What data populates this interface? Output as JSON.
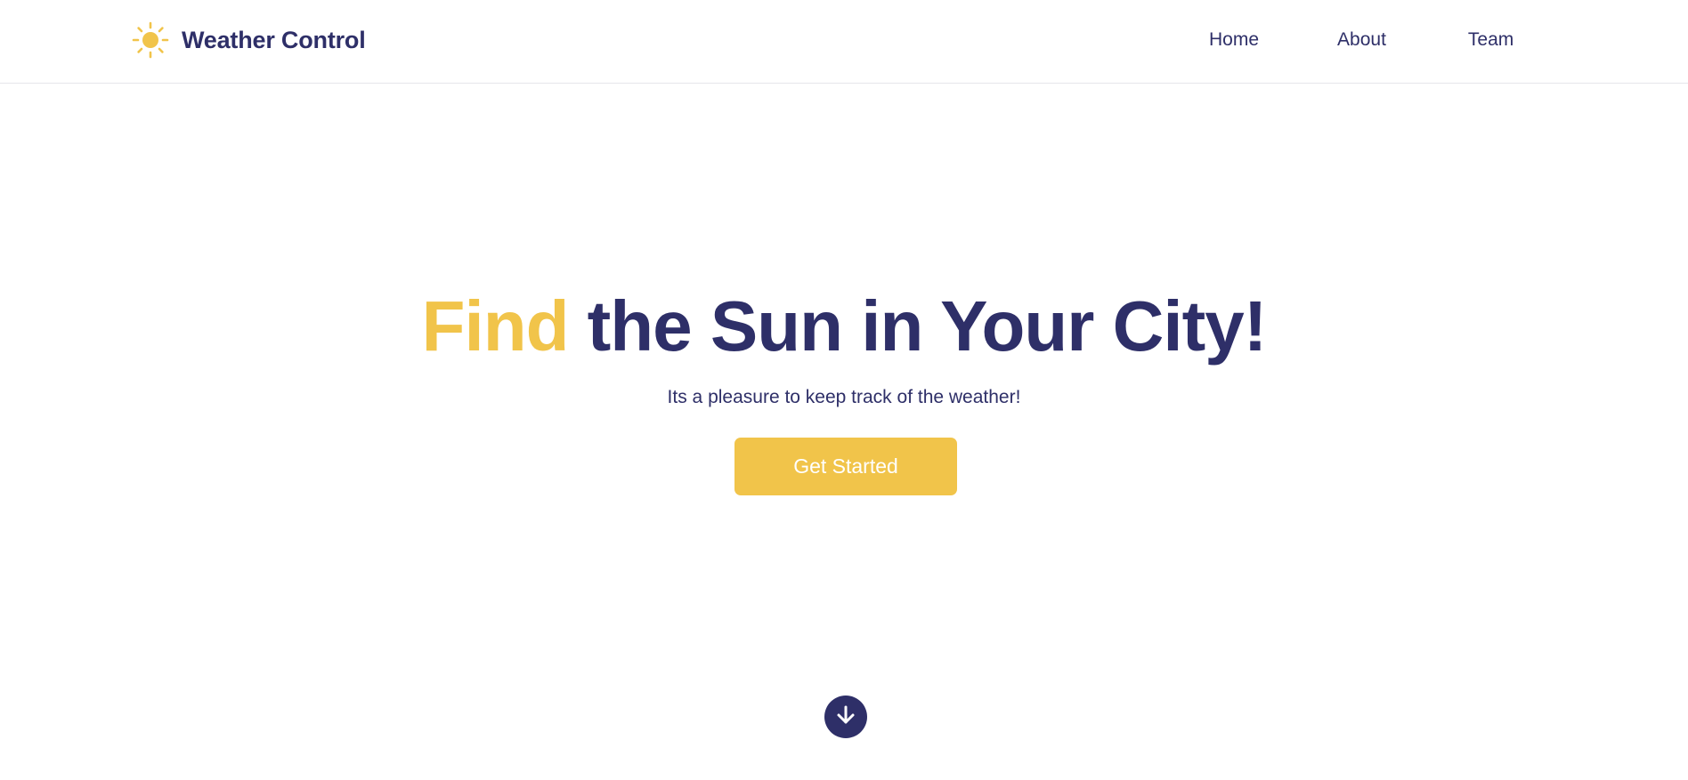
{
  "header": {
    "brand_name": "Weather Control",
    "brand_icon": "sun-icon",
    "nav": [
      {
        "label": "Home"
      },
      {
        "label": "About"
      },
      {
        "label": "Team"
      }
    ]
  },
  "hero": {
    "title_accent": "Find",
    "title_rest": " the Sun in Your City!",
    "subtitle": "Its a pleasure to keep track of the weather!",
    "cta_label": "Get Started",
    "scroll_icon": "arrow-down-circle-icon"
  },
  "colors": {
    "accent": "#f1c44a",
    "primary": "#2e2f68",
    "background": "#ffffff"
  }
}
